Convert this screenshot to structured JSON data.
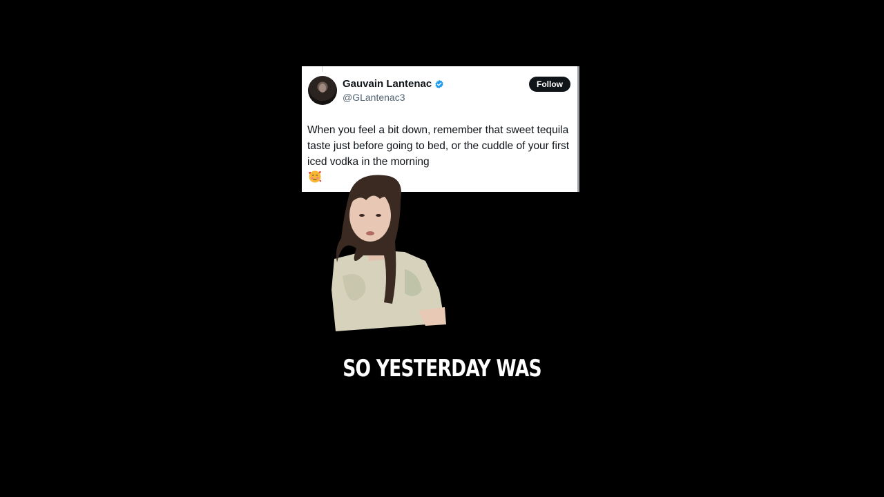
{
  "tweet": {
    "display_name": "Gauvain Lantenac",
    "handle": "@GLantenac3",
    "follow_label": "Follow",
    "text": "When you feel a bit down, remember that sweet tequila taste just before going to bed, or the cuddle of your first iced vodka in the morning",
    "emoji": "smiling-face-with-hearts",
    "verified_icon": "verified-badge-icon",
    "verified_color": "#1d9bf0"
  },
  "caption": {
    "text": "SO YESTERDAY WAS"
  }
}
